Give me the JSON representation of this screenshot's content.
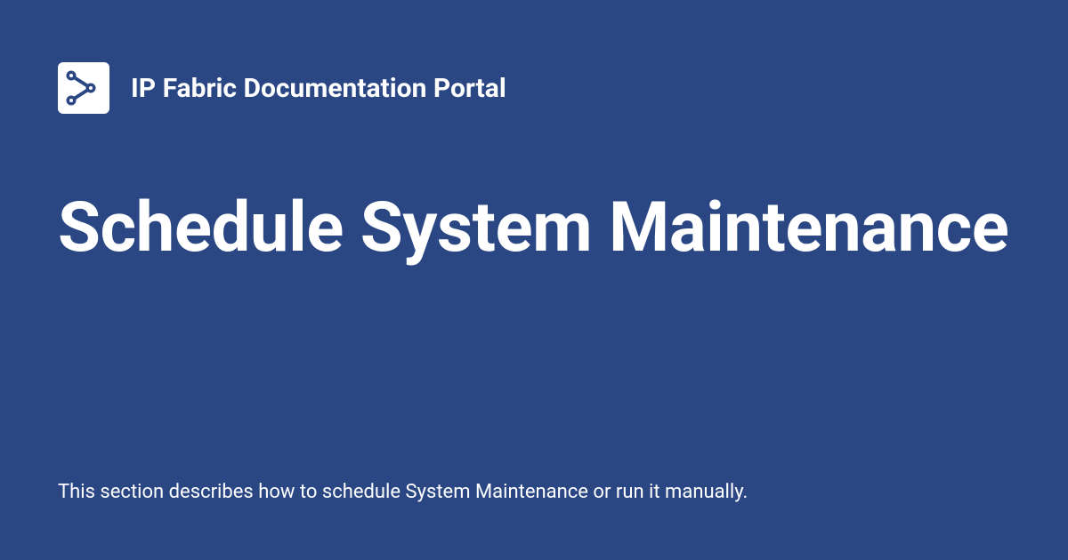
{
  "header": {
    "site_name": "IP Fabric Documentation Portal"
  },
  "page": {
    "title": "Schedule System Maintenance",
    "description": "This section describes how to schedule System Maintenance or run it manually."
  },
  "colors": {
    "background": "#2a4784",
    "text": "#ffffff",
    "logo_bg": "#ffffff",
    "logo_fg": "#2a4784"
  }
}
